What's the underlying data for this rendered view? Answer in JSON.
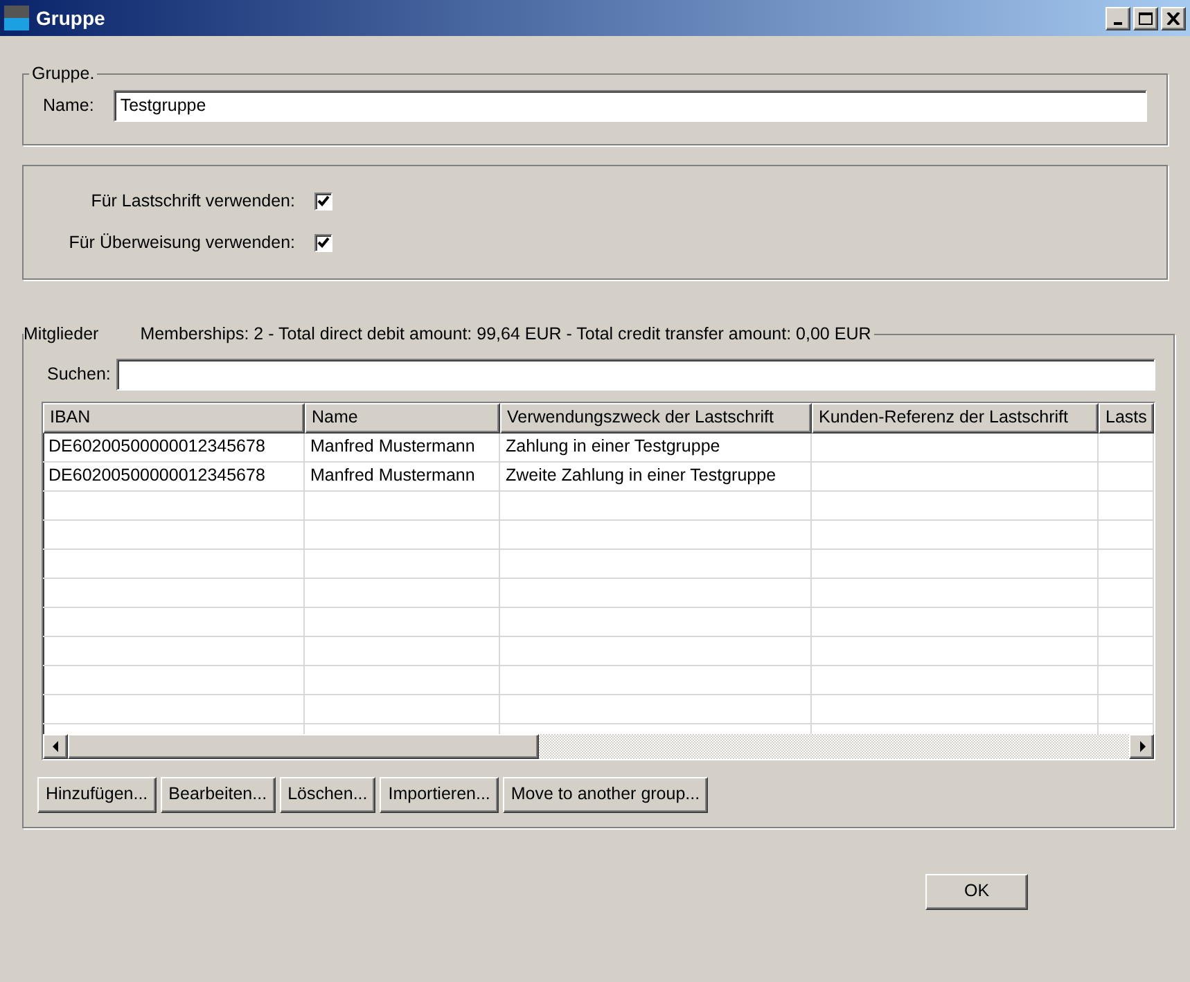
{
  "window": {
    "title": "Gruppe"
  },
  "group": {
    "legend": "Gruppe.",
    "name_label": "Name:",
    "name_value": "Testgruppe"
  },
  "options": [
    {
      "label": "Für Lastschrift verwenden:",
      "checked": true
    },
    {
      "label": "Für Überweisung verwenden:",
      "checked": true
    }
  ],
  "members": {
    "legend": "Mitglieder",
    "summary": "Memberships: 2 - Total direct debit amount: 99,64 EUR - Total credit transfer amount: 0,00 EUR",
    "search_label": "Suchen:",
    "table": {
      "columns": [
        "IBAN",
        "Name",
        "Verwendungszweck der Lastschrift",
        "Kunden-Referenz der Lastschrift",
        "Lasts"
      ],
      "rows": [
        [
          "DE60200500000012345678",
          "Manfred Mustermann",
          "Zahlung in einer Testgruppe"
        ],
        [
          "DE60200500000012345678",
          "Manfred Mustermann",
          "Zweite Zahlung in einer Testgruppe"
        ]
      ]
    },
    "buttons": [
      "Hinzufügen...",
      "Bearbeiten...",
      "Löschen...",
      "Importieren...",
      "Move to another group..."
    ]
  },
  "ok": "OK"
}
